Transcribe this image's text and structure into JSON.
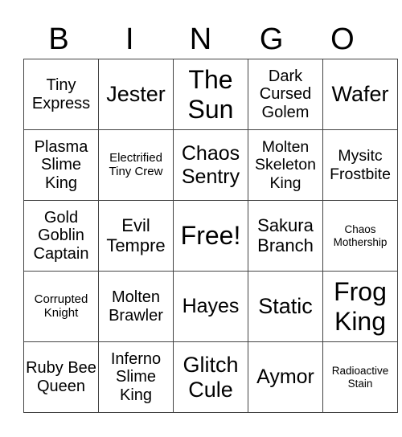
{
  "header": [
    "B",
    "I",
    "N",
    "G",
    "O"
  ],
  "rows": [
    [
      "Tiny Express",
      "Jester",
      "The Sun",
      "Dark Cursed Golem",
      "Wafer"
    ],
    [
      "Plasma Slime King",
      "Electrified Tiny Crew",
      "Chaos Sentry",
      "Molten Skeleton King",
      "Mysitc Frostbite"
    ],
    [
      "Gold Goblin Captain",
      "Evil Tempre",
      "Free!",
      "Sakura Branch",
      "Chaos Mothership"
    ],
    [
      "Corrupted Knight",
      "Molten Brawler",
      "Hayes",
      "Static",
      "Frog King"
    ],
    [
      "Ruby Bee Queen",
      "Inferno Slime King",
      "Glitch Cule",
      "Aymor",
      "Radioactive Stain"
    ]
  ]
}
